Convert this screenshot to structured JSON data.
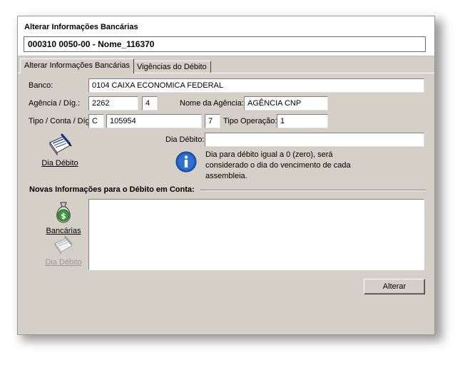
{
  "header": {
    "title": "Alterar Informações Bancárias",
    "account": "000310 0050-00 - Nome_116370"
  },
  "tabs": [
    {
      "label": "Alterar Informações Bancárias",
      "active": true
    },
    {
      "label": "Vigências do Débito",
      "active": false
    }
  ],
  "form": {
    "banco_label": "Banco:",
    "banco_value": "0104  CAIXA ECONOMICA FEDERAL",
    "agencia_label": "Agência / Díg.:",
    "agencia_value": "2262",
    "agencia_digito": "4",
    "nome_agencia_label": "Nome da Agência:",
    "nome_agencia_value": "AGÊNCIA CNP",
    "tipo_conta_label": "Tipo / Conta / Díg:",
    "tipo_value": "C",
    "conta_value": "105954",
    "conta_digito": "7",
    "tipo_operacao_label": "Tipo Operação:",
    "tipo_operacao_value": "1",
    "dia_debito_label": "Dia Débito:",
    "dia_debito_value": "",
    "info_text": "Dia para débito igual a 0 (zero), será considerado o dia do vencimento de cada assembleia."
  },
  "buttons": {
    "dia_debito": "Dia Débito",
    "bancarias": "Bancárias",
    "dia_debito_disabled": "Dia Débito",
    "alterar": "Alterar"
  },
  "group": {
    "title": "Novas Informações para o Débito em Conta:"
  },
  "colors": {
    "window_bg": "#d4d0c8",
    "info_icon": "#1f5fbf",
    "money_bag": "#3a9a3a"
  }
}
